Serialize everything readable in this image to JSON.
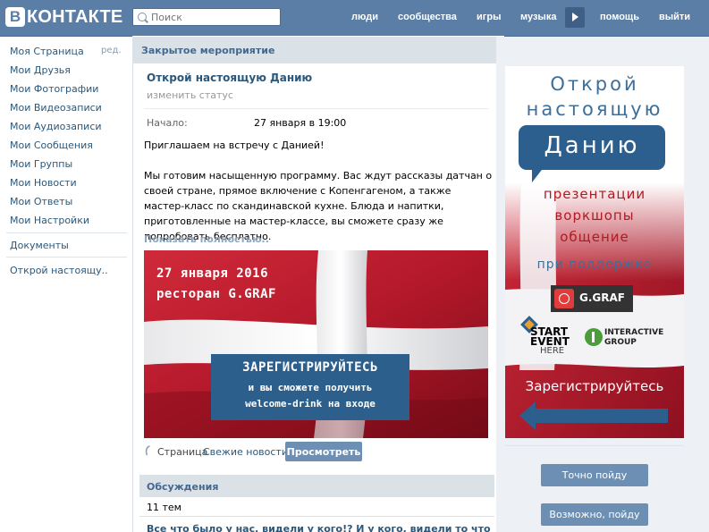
{
  "header": {
    "logo_letter": "В",
    "logo_text": "КОНТАКТЕ",
    "search_placeholder": "Поиск",
    "nav": {
      "people": "люди",
      "communities": "сообщества",
      "games": "игры",
      "music": "музыка",
      "help": "помощь",
      "logout": "выйти"
    }
  },
  "sidebar": {
    "edit": "ред.",
    "items": [
      "Моя Страница",
      "Мои Друзья",
      "Мои Фотографии",
      "Мои Видеозаписи",
      "Мои Аудиозаписи",
      "Мои Сообщения",
      "Мои Группы",
      "Мои Новости",
      "Мои Ответы",
      "Мои Настройки"
    ],
    "documents": "Документы",
    "event_link": "Открой настоящу.."
  },
  "event": {
    "section": "Закрытое мероприятие",
    "title": "Открой настоящую Данию",
    "status": "изменить статус",
    "start_label": "Начало:",
    "start_value": "27 января в 19:00",
    "desc_1": "Приглашаем на встречу с Данией!",
    "desc_2": "Мы готовим насыщенную программу. Вас ждут рассказы датчан о своей стране, прямое включение с Копенгагеном, а также мастер-класс по скандинавской кухне. Блюда и напитки, приготовленные на мастер-классе, вы сможете сразу же попробовать бесплатно.",
    "show_more": "Показать полностью..",
    "banner": {
      "date": "27 января 2016",
      "place": "ресторан G.GRAF",
      "reg_1": "ЗАРЕГИСТРИРУЙТЕСЬ",
      "reg_2": "и вы сможете получить",
      "reg_3": "welcome-drink на входе"
    },
    "source_prefix": "Страница",
    "source_name": "Свежие новости",
    "view_button": "Просмотреть"
  },
  "discussions": {
    "header": "Обсуждения",
    "count": "11 тем",
    "topic": "Все что было у нас, видели у кого!?  И у кого, видели то что было"
  },
  "poster": {
    "line_1": "Открой",
    "line_2": "настоящую",
    "line_3": "Данию",
    "item_1": "презентации",
    "item_2": "воркшопы",
    "item_3": "общение",
    "support": "при поддержке",
    "sponsor_1": "G.GRAF",
    "sponsor_2a": "START",
    "sponsor_2b": "EVENT",
    "sponsor_2c": "HERE",
    "sponsor_3a": "INTERACTIVE",
    "sponsor_3b": "GROUP",
    "register": "Зарегистрируйтесь"
  },
  "actions": {
    "going": "Точно пойду",
    "maybe": "Возможно, пойду"
  }
}
